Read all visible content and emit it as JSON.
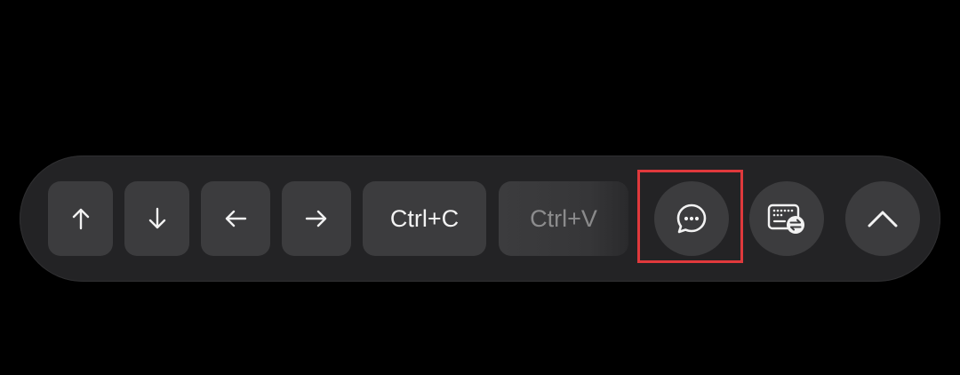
{
  "toolbar": {
    "keys": [
      {
        "label": "↑",
        "icon": "arrow-up-icon"
      },
      {
        "label": "↓",
        "icon": "arrow-down-icon"
      },
      {
        "label": "←",
        "icon": "arrow-left-icon"
      },
      {
        "label": "→",
        "icon": "arrow-right-icon"
      },
      {
        "label": "Ctrl+C"
      },
      {
        "label": "Ctrl+V"
      }
    ],
    "buttons": [
      {
        "icon": "chat-bubble-icon",
        "highlighted": true
      },
      {
        "icon": "keyboard-switch-icon"
      },
      {
        "icon": "chevron-up-icon"
      }
    ]
  },
  "colors": {
    "background": "#000000",
    "toolbar": "#232325",
    "key": "#3c3c3e",
    "text": "#f2f2f2",
    "highlight": "#e0393c"
  }
}
